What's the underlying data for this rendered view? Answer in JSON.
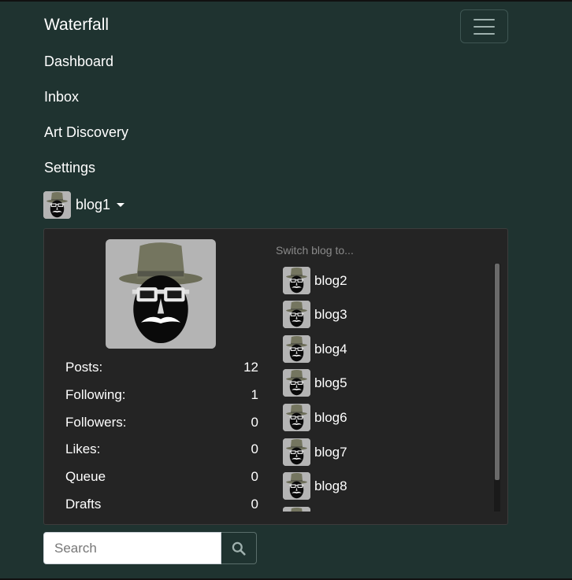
{
  "navbar": {
    "brand": "Waterfall",
    "links": [
      "Dashboard",
      "Inbox",
      "Art Discovery",
      "Settings"
    ],
    "current_blog": "blog1"
  },
  "blog_panel": {
    "stats": [
      {
        "label": "Posts:",
        "value": "12"
      },
      {
        "label": "Following:",
        "value": "1"
      },
      {
        "label": "Followers:",
        "value": "0"
      },
      {
        "label": "Likes:",
        "value": "0"
      },
      {
        "label": "Queue",
        "value": "0"
      },
      {
        "label": "Drafts",
        "value": "0"
      }
    ],
    "switch_label": "Switch blog to...",
    "blogs": [
      "blog2",
      "blog3",
      "blog4",
      "blog5",
      "blog6",
      "blog7",
      "blog8"
    ]
  },
  "search": {
    "placeholder": "Search",
    "icon": "search-icon"
  },
  "colors": {
    "background": "#1f3330",
    "panel": "#242424",
    "avatar_bg": "#bdbdbd",
    "hat": "#6f705b"
  }
}
